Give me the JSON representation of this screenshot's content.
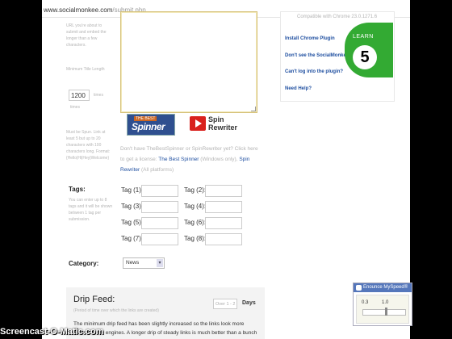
{
  "browser": {
    "url_domain": "www.socialmonkee.com",
    "url_path": "/submit.php"
  },
  "left_column": {
    "intro_lines": [
      "URL you're about to",
      "submit and embed the",
      "longer than a few",
      "characters."
    ],
    "minimum_title": "Minimum Title Length",
    "minimum_value": "1200",
    "minimum_unit": "times",
    "minimum_unit2": "times",
    "spin_note_lines": [
      "Must be Spun. Link at",
      "least 5 but up to 20",
      "characters with 100",
      "characters long. Format:",
      "{Hello|Hi|Hey|Welcome}"
    ]
  },
  "spinners": {
    "best_spinner_top": "THE BEST",
    "best_spinner_name": "Spinner",
    "spin_rewriter_line1": "Spin",
    "spin_rewriter_line2": "Rewriter",
    "note_prefix": "Don't have TheBestSpinner or SpinRewriter yet? Click here to get a license:",
    "note_link1": "The Best Spinner",
    "note_middle": "(Windows only),",
    "note_link2": "Spin Rewriter",
    "note_suffix": "(All platforms)"
  },
  "tags": {
    "label": "Tags:",
    "note_lines": [
      "You can enter up to 8",
      "tags and it will be shown",
      "between 1 tag per",
      "submission."
    ],
    "items": [
      {
        "label": "Tag (1):"
      },
      {
        "label": "Tag (2):"
      },
      {
        "label": "Tag (3):"
      },
      {
        "label": "Tag (4):"
      },
      {
        "label": "Tag (5):"
      },
      {
        "label": "Tag (6):"
      },
      {
        "label": "Tag (7):"
      },
      {
        "label": "Tag (8):"
      }
    ]
  },
  "category": {
    "label": "Category:",
    "selected": "News",
    "arrow": "▾"
  },
  "drip_feed": {
    "title": "Drip Feed:",
    "subtitle": "(Period of time over which the links are created)",
    "selected": "Over 1 - 2",
    "days_label": "Days",
    "description": "The minimum drip feed has been slightly increased so the links look more natural to the engines. A longer drip of steady links is much better than a bunch all at once."
  },
  "right_panel": {
    "compat": "Compatible with Chrome 23.0.1271.6",
    "links": [
      "Install Chrome Plugin",
      "Don't see the SocialMonkee head?",
      "Can't log into the plugin?",
      "Need Help?"
    ]
  },
  "badge": {
    "learn_text": "LEARN",
    "number": "5"
  },
  "speed_widget": {
    "title": "Enounce MySpeed®",
    "min_label": "0.3",
    "mid_label": "1.0",
    "speed_value": 1.0
  },
  "watermark": "Screencast-O-Matic.com",
  "colors": {
    "link_blue": "#1f4fa0",
    "badge_green": "#33aa33",
    "spin_rewriter_red": "#d9211d"
  }
}
